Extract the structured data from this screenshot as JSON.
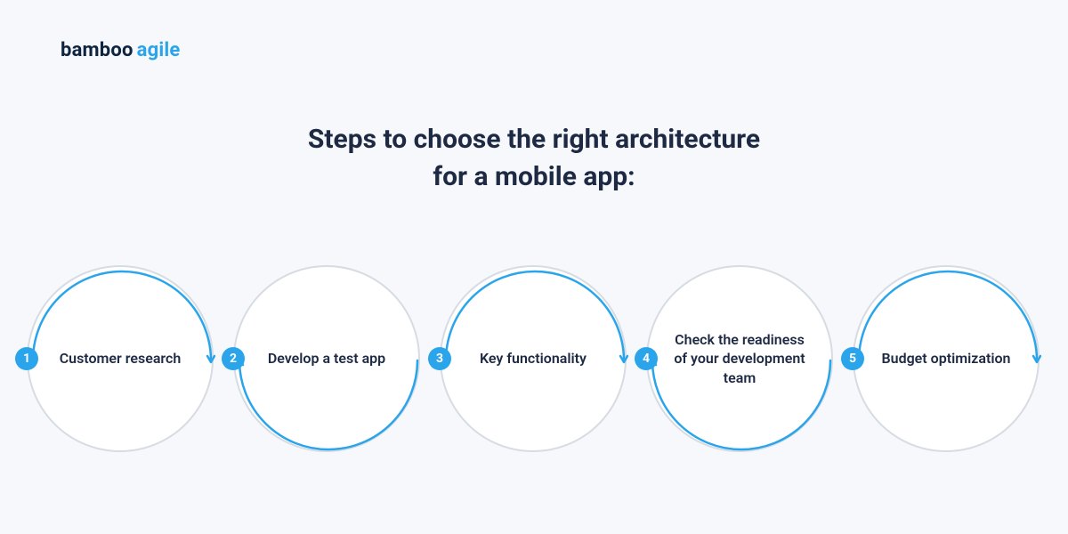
{
  "logo": {
    "brand1": "bamboo",
    "brand2": "agile"
  },
  "title": {
    "line1": "Steps to choose the right architecture",
    "line2": "for a mobile app:"
  },
  "colors": {
    "blue": "#2aa4ea",
    "grey": "#d7dce2"
  },
  "steps": [
    {
      "n": "1",
      "label": "Customer research"
    },
    {
      "n": "2",
      "label": "Develop a test app"
    },
    {
      "n": "3",
      "label": "Key functionality"
    },
    {
      "n": "4",
      "label": "Check the readiness of your development team"
    },
    {
      "n": "5",
      "label": "Budget optimization"
    }
  ]
}
